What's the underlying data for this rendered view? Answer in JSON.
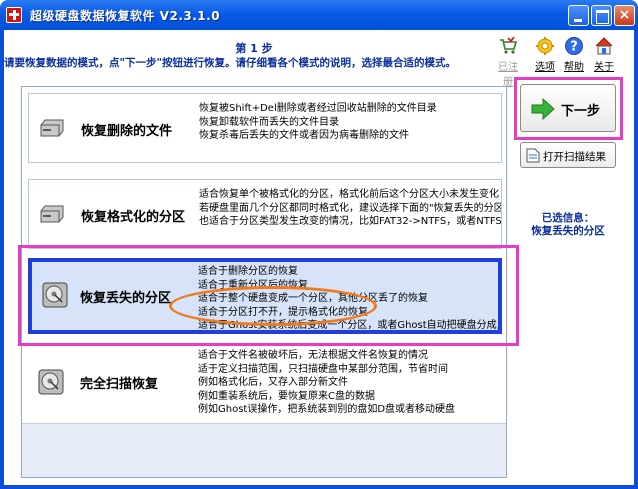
{
  "window": {
    "title": "超级硬盘数据恢复软件 V2.3.1.0",
    "close_glyph": "×"
  },
  "header": {
    "step": "第 1 步",
    "instruction": "请要恢复数据的模式，点\"下一步\"按钮进行恢复。请仔细看各个模式的说明，选择最合适的模式。"
  },
  "toolbar": [
    {
      "label": "已注册",
      "icon": "cart-icon",
      "disabled": true
    },
    {
      "label": "选项",
      "icon": "gear-icon",
      "disabled": false
    },
    {
      "label": "帮助",
      "icon": "help-icon",
      "disabled": false
    },
    {
      "label": "关于",
      "icon": "home-icon",
      "disabled": false
    }
  ],
  "options": [
    {
      "title": "恢复删除的文件",
      "lines": [
        "恢复被Shift+Del删除或者经过回收站删除的文件目录",
        "恢复卸载软件而丢失的文件目录",
        "恢复杀毒后丢失的文件或者因为病毒删除的文件"
      ],
      "selected": false
    },
    {
      "title": "恢复格式化的分区",
      "lines": [
        "适合恢复单个被格式化的分区，格式化前后这个分区大小未发生变化",
        "若硬盘里面几个分区都同时格式化，建议选择下面的\"恢复丢失的分区",
        "也适合于分区类型发生改变的情况，比如FAT32->NTFS，或者NTFS->F"
      ],
      "selected": false
    },
    {
      "title": "恢复丢失的分区",
      "lines": [
        "适合于删除分区的恢复",
        "适合于重新分区后的恢复",
        "适合于整个硬盘变成一个分区，其他分区丢了的恢复",
        "适合于分区打不开，提示格式化的恢复",
        "适合于Ghost安装系统后变成一个分区，或者Ghost自动把硬盘分成几个"
      ],
      "selected": true
    },
    {
      "title": "完全扫描恢复",
      "lines": [
        "适合于文件名被破坏后，无法根据文件名恢复的情况",
        "适于定义扫描范围，只扫描硬盘中某部分范围，节省时间",
        "例如格式化后，又存入部分新文件",
        "例如重装系统后，要恢复原来C盘的数据",
        "例如Ghost误操作，把系统装到别的盘如D盘或者移动硬盘"
      ],
      "selected": false
    }
  ],
  "sidebar": {
    "next_label": "下一步",
    "open_scan_label": "打开扫描结果",
    "selected_info_label": "已选信息：",
    "selected_info_value": "恢复丢失的分区"
  },
  "colors": {
    "accent": "#1f3fd6",
    "highlight_pink": "#e63cc6",
    "annotation_orange": "#f07b1e",
    "title_blue": "#0c2f9c"
  }
}
